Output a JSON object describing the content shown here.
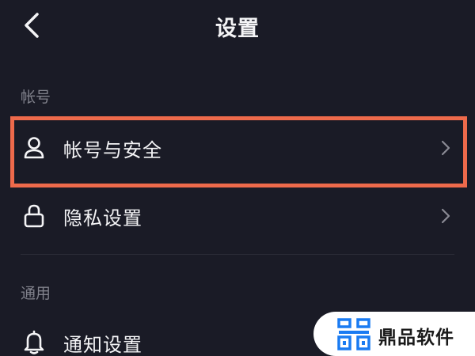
{
  "header": {
    "title": "设置"
  },
  "sections": {
    "account": {
      "header": "帐号",
      "items": [
        {
          "label": "帐号与安全",
          "icon": "user-icon"
        },
        {
          "label": "隐私设置",
          "icon": "lock-icon"
        }
      ]
    },
    "general": {
      "header": "通用",
      "items": [
        {
          "label": "通知设置",
          "icon": "bell-icon"
        }
      ]
    }
  },
  "colors": {
    "background": "#1a1b26",
    "highlight": "#ee6a4b",
    "watermark_blue": "#1a7bf2"
  },
  "watermark": {
    "text": "鼎品软件",
    "icon": "watermark-logo-icon"
  }
}
